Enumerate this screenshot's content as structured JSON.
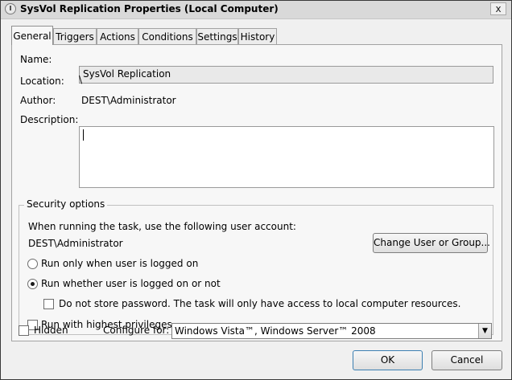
{
  "window": {
    "title": "SysVol Replication Properties (Local Computer)",
    "close_glyph": "x"
  },
  "tabs": [
    {
      "label": "General",
      "active": true
    },
    {
      "label": "Triggers",
      "active": false
    },
    {
      "label": "Actions",
      "active": false
    },
    {
      "label": "Conditions",
      "active": false
    },
    {
      "label": "Settings",
      "active": false
    },
    {
      "label": "History",
      "active": false
    }
  ],
  "general": {
    "name_label": "Name:",
    "name_value": "SysVol Replication",
    "location_label": "Location:",
    "location_value": "\\",
    "author_label": "Author:",
    "author_value": "DEST\\Administrator",
    "description_label": "Description:",
    "description_value": ""
  },
  "security": {
    "title": "Security options",
    "account_prompt": "When running the task, use the following user account:",
    "account_value": "DEST\\Administrator",
    "change_button": "Change User or Group...",
    "run_logged_on": {
      "label": "Run only when user is logged on",
      "selected": false
    },
    "run_whether": {
      "label": "Run whether user is logged on or not",
      "selected": true
    },
    "no_store_password": {
      "label": "Do not store password.  The task will only have access to local computer resources.",
      "checked": false
    },
    "highest_privileges": {
      "label": "Run with highest privileges",
      "checked": false
    }
  },
  "footer": {
    "hidden_label": "Hidden",
    "hidden_checked": false,
    "configure_label": "Configure for:",
    "configure_value": "Windows Vista™, Windows Server™ 2008",
    "ok_button": "OK",
    "cancel_button": "Cancel"
  },
  "icons": {
    "title_icon": "task-clock-icon",
    "dropdown_icon": "chevron-down-icon"
  }
}
